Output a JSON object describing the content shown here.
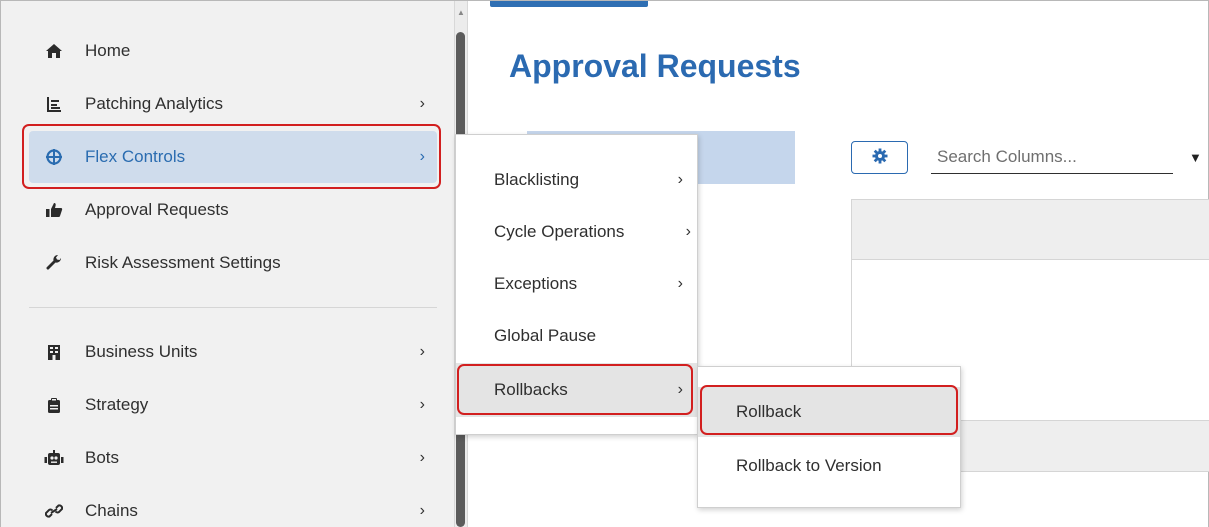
{
  "sidebar": {
    "items": [
      {
        "label": "Home",
        "icon": "home-icon",
        "chevron": ""
      },
      {
        "label": "Patching Analytics",
        "icon": "analytics-icon",
        "chevron": "›"
      },
      {
        "label": "Flex Controls",
        "icon": "crosshair-icon",
        "chevron": "›",
        "active": true
      },
      {
        "label": "Approval Requests",
        "icon": "thumbs-up-icon",
        "chevron": ""
      },
      {
        "label": "Risk Assessment Settings",
        "icon": "wrench-icon",
        "chevron": ""
      },
      {
        "label": "Business Units",
        "icon": "building-icon",
        "chevron": "›"
      },
      {
        "label": "Strategy",
        "icon": "clipboard-icon",
        "chevron": "›"
      },
      {
        "label": "Bots",
        "icon": "robot-icon",
        "chevron": "›"
      },
      {
        "label": "Chains",
        "icon": "link-icon",
        "chevron": "›"
      }
    ]
  },
  "main": {
    "title": "Approval Requests",
    "search_placeholder": "Search Columns...",
    "settings_icon": "gear-icon"
  },
  "flex_menu": {
    "items": [
      {
        "label": "Blacklisting",
        "chevron": "›"
      },
      {
        "label": "Cycle Operations",
        "chevron": "›"
      },
      {
        "label": "Exceptions",
        "chevron": "›"
      },
      {
        "label": "Global Pause",
        "chevron": ""
      },
      {
        "label": "Rollbacks",
        "chevron": "›"
      }
    ]
  },
  "rollbacks_menu": {
    "items": [
      {
        "label": "Rollback"
      },
      {
        "label": "Rollback to Version"
      }
    ]
  },
  "colors": {
    "accent": "#2b6ab1",
    "highlight_border": "#d21f1f",
    "active_bg": "#cfdcec"
  }
}
